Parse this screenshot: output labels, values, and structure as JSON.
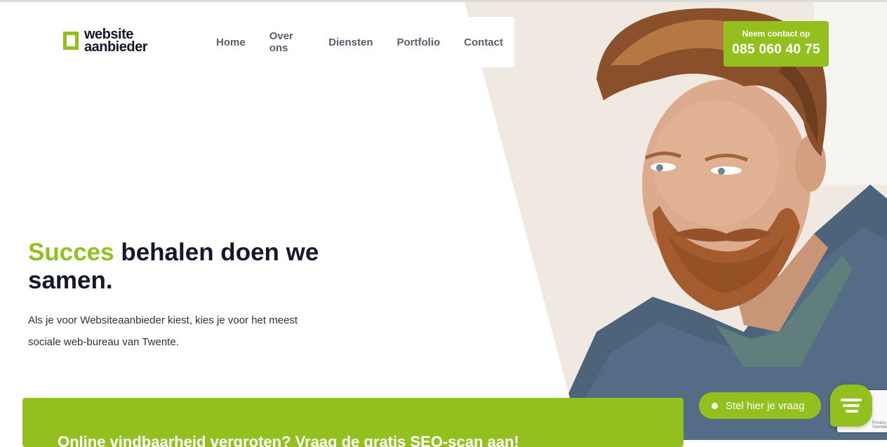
{
  "logo": {
    "line1": "website",
    "line2": "aanbieder"
  },
  "nav": {
    "items": [
      "Home",
      "Over ons",
      "Diensten",
      "Portfolio",
      "Contact"
    ]
  },
  "contact": {
    "label": "Neem contact op",
    "phone": "085 060 40 75"
  },
  "hero": {
    "title_accent": "Succes",
    "title_rest": "behalen doen we samen.",
    "subtitle": "Als je voor Websiteaanbieder kiest, kies je voor het meest sociale web-bureau van Twente."
  },
  "banner": {
    "text": "Online vindbaarheid vergroten? Vraag de gratis SEO-scan aan!"
  },
  "chat": {
    "label": "Stel hier je vraag"
  },
  "recaptcha": {
    "text": "Privacy - Voorwaarden"
  },
  "colors": {
    "accent": "#93c01f",
    "dark": "#15182b"
  },
  "icons": {
    "chat": "chat-lines-icon",
    "recaptcha": "recaptcha-icon",
    "logo": "logo-square-icon"
  }
}
